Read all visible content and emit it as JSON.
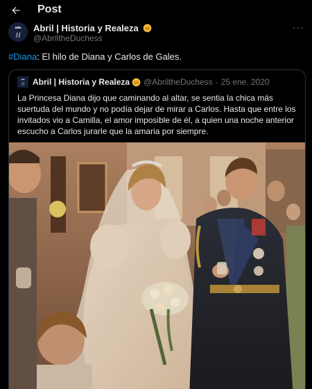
{
  "header": {
    "title": "Post"
  },
  "author": {
    "name": "Abril | Historia y Realeza",
    "handle": "@AbriltheDuchess"
  },
  "tweet": {
    "hashtag": "#Diana",
    "text": ": El hilo de Diana y Carlos de Gales."
  },
  "quoted": {
    "name": "Abril | Historia y Realeza",
    "handle": "@AbriltheDuchess",
    "separator": "·",
    "date": "25 ene. 2020",
    "text": "La Princesa Diana dijo que caminando al altar, se sentia la chica más suertuda del mundo y no podía dejar de mirar a Carlos. Hasta que entre los invitados vio a Camilla, el amor imposible de él, a quien una noche anterior escucho a Carlos jurarle que la amaria por siempre."
  },
  "icons": {
    "back": "arrow-left-icon",
    "more": "more-horizontal-icon",
    "emoji": "crown-emoji-icon"
  },
  "colors": {
    "background": "#000000",
    "text": "#e7e9ea",
    "muted": "#71767b",
    "link": "#1d9bf0",
    "border": "#2f3336"
  }
}
